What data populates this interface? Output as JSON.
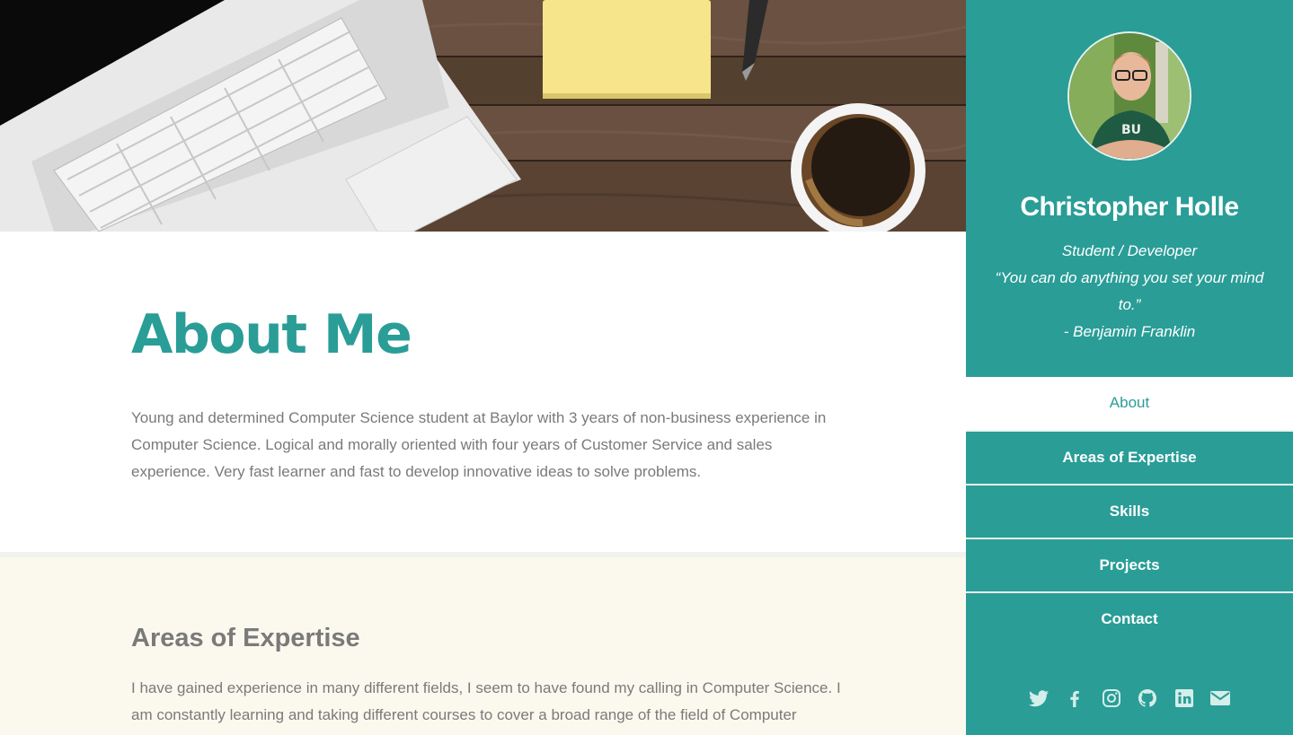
{
  "profile": {
    "name": "Christopher Holle",
    "role": "Student / Developer",
    "quote": "“You can do anything you set your mind to.”",
    "quote_author": "- Benjamin Franklin"
  },
  "nav": {
    "items": [
      {
        "label": "About",
        "active": true
      },
      {
        "label": "Areas of Expertise",
        "active": false
      },
      {
        "label": "Skills",
        "active": false
      },
      {
        "label": "Projects",
        "active": false
      },
      {
        "label": "Contact",
        "active": false
      }
    ]
  },
  "social": {
    "icons": [
      "twitter-icon",
      "facebook-icon",
      "instagram-icon",
      "github-icon",
      "linkedin-icon",
      "email-icon"
    ]
  },
  "about": {
    "title": "About Me",
    "body": "Young and determined Computer Science student at Baylor with 3 years of non-business experience in Computer Science. Logical and morally oriented with four years of Customer Service and sales experience. Very fast learner and fast to develop innovative ideas to solve problems."
  },
  "expertise": {
    "title": "Areas of Expertise",
    "body": "I have gained experience in many different fields, I seem to have found my calling in Computer Science. I am constantly learning and taking different courses to cover a broad range of the field of Computer"
  },
  "colors": {
    "accent": "#2a9d97",
    "text": "#7a7a7a",
    "expertise_bg": "#fbf9ee"
  }
}
